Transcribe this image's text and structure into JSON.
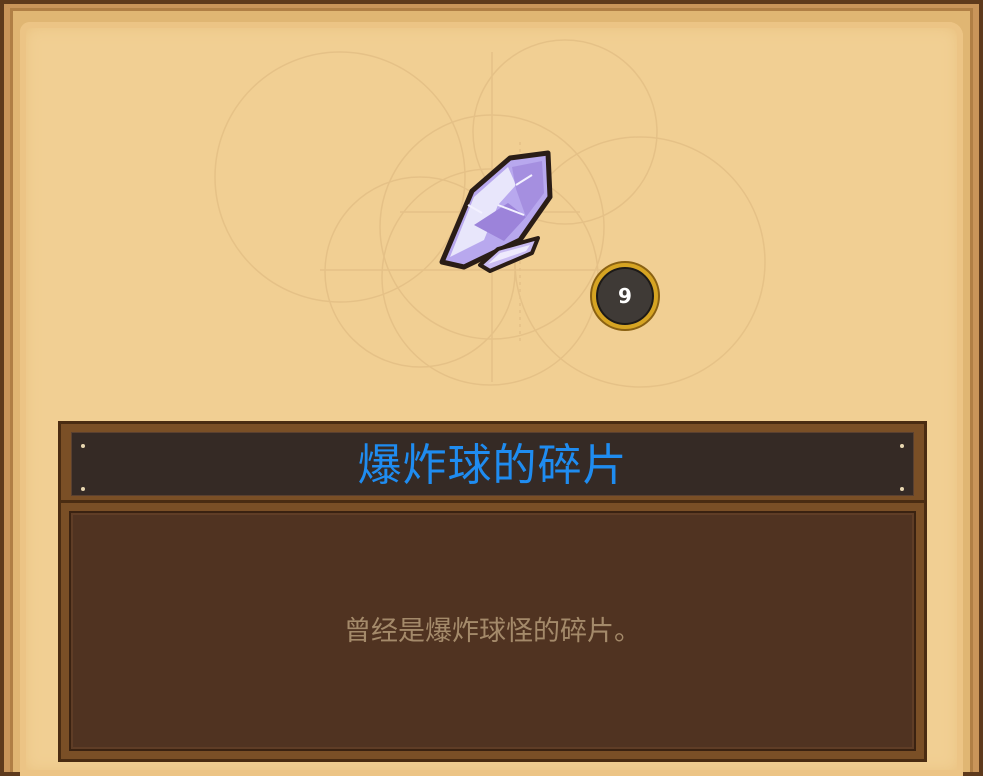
{
  "item": {
    "name": "爆炸球的碎片",
    "description": "曾经是爆炸球怪的碎片。",
    "count": "9",
    "icon": "crystal-shard-icon"
  },
  "colors": {
    "title": "#1f8cf0",
    "description": "#a48a6a",
    "parchment": "#f1cf93",
    "panel": "#503321",
    "badge_ring": "#d6a422"
  }
}
